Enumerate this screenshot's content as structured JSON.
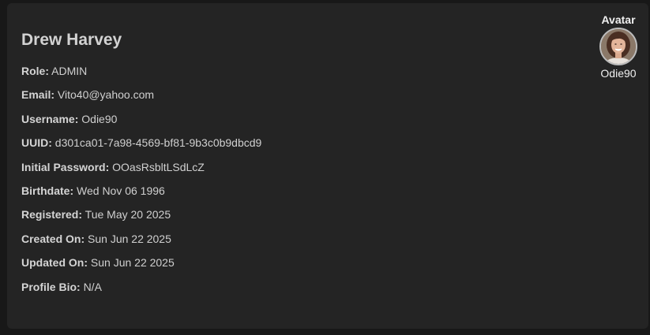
{
  "profile": {
    "name": "Drew Harvey",
    "fields": [
      {
        "label": "Role:",
        "value": "ADMIN"
      },
      {
        "label": "Email:",
        "value": "Vito40@yahoo.com"
      },
      {
        "label": "Username:",
        "value": "Odie90"
      },
      {
        "label": "UUID:",
        "value": "d301ca01-7a98-4569-bf81-9b3c0b9dbcd9"
      },
      {
        "label": "Initial Password:",
        "value": "OOasRsbltLSdLcZ"
      },
      {
        "label": "Birthdate:",
        "value": "Wed Nov 06 1996"
      },
      {
        "label": "Registered:",
        "value": "Tue May 20 2025"
      },
      {
        "label": "Created On:",
        "value": "Sun Jun 22 2025"
      },
      {
        "label": "Updated On:",
        "value": "Sun Jun 22 2025"
      },
      {
        "label": "Profile Bio:",
        "value": "N/A"
      }
    ]
  },
  "avatar": {
    "title": "Avatar",
    "username": "Odie90",
    "icon": "user-avatar-photo"
  },
  "colors": {
    "background": "#181818",
    "card": "#242424",
    "text": "#d0d0d0",
    "heading": "#d2d2d2"
  }
}
